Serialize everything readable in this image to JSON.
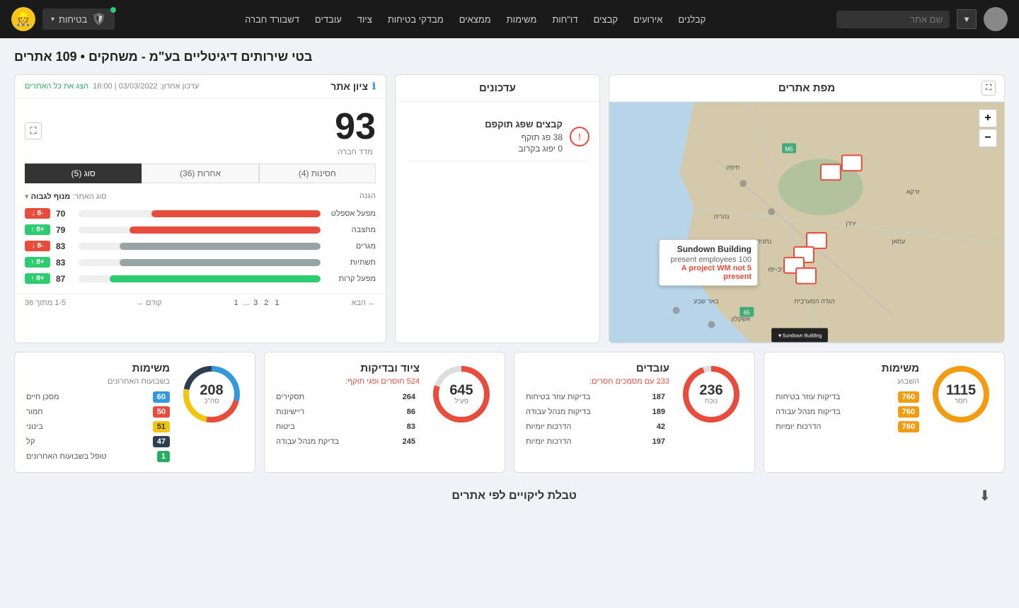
{
  "header": {
    "search_placeholder": "שם אתר",
    "nav_items": [
      "קבלנים",
      "אירועים",
      "קבצים",
      "דו\"חות",
      "משימות",
      "ממצאים",
      "מבדקי בטיחות",
      "ציוד",
      "עובדים",
      "דשבורד חברה"
    ],
    "security_btn": "בטיחות",
    "dropdown_arrow": "▾"
  },
  "page": {
    "title": "בטי שירותים דיגיטליים בע\"מ - משחקים • 109 אתרים"
  },
  "map": {
    "title": "מפת אתרים",
    "popup_title": "Sundown Building",
    "popup_line1": "100 present employees",
    "popup_wm": "5 A project",
    "popup_wm_label": "WM not present"
  },
  "updates": {
    "title": "עדכונים",
    "items": [
      {
        "label": "קבצים שפג תוקפם",
        "count": ""
      },
      {
        "label": "38 פג תוקף",
        "count": ""
      },
      {
        "label": "0 יפוג בקרוב",
        "count": ""
      }
    ]
  },
  "score": {
    "title": "ציון אתר",
    "update_label": "עדכון אחרון: 03/03/2022 | 16:00",
    "view_all_link": "הצג את כל האתרים",
    "score_number": "93",
    "score_sublabel": "מדד חברה",
    "type_label": "סוג האתר:",
    "type_value": "מנוף לגבוה",
    "tabs": [
      {
        "label": "חסינות (4)",
        "active": false
      },
      {
        "label": "אחרות (36)",
        "active": false
      },
      {
        "label": "סוג (5)",
        "active": true
      }
    ],
    "header_legend": "הגנה",
    "rows": [
      {
        "label": "מפעל אספלט",
        "value": 70,
        "badge": "-8",
        "badge_type": "red",
        "bar_color": "#e74c3c",
        "bar_pct": 70
      },
      {
        "label": "מחצבה",
        "value": 79,
        "badge": "+8",
        "badge_type": "green",
        "bar_color": "#e74c3c",
        "bar_pct": 79
      },
      {
        "label": "מגרים",
        "value": 83,
        "badge": "-8",
        "badge_type": "red",
        "bar_color": "#95a5a6",
        "bar_pct": 83
      },
      {
        "label": "תשתיות",
        "value": 83,
        "badge": "+8",
        "badge_type": "green",
        "bar_color": "#95a5a6",
        "bar_pct": 83
      },
      {
        "label": "מפעל קרות",
        "value": 87,
        "badge": "+8",
        "badge_type": "green",
        "bar_color": "#2ecc71",
        "bar_pct": 87
      }
    ],
    "pagination": {
      "range": "1-5 מתוך 36",
      "pages": [
        "1",
        "2",
        "3",
        "...",
        "1"
      ],
      "next": "הבא",
      "prev": "קודם"
    }
  },
  "stats": [
    {
      "id": "missions1",
      "title": "משימות",
      "subtitle": "השבוע",
      "subtitle_color": "normal",
      "number": "1115",
      "sublabel": "חסר",
      "donut_segments": [
        {
          "color": "#f39c12",
          "pct": 100
        }
      ],
      "donut_bg": "#ddd",
      "rows": [
        {
          "label": "בדיקות עוזר בטיחות",
          "badge": "760",
          "badge_color": "orange"
        },
        {
          "label": "בדיקות מנהל עבודה",
          "badge": "760",
          "badge_color": "orange"
        },
        {
          "label": "הדרכות יומיות",
          "badge": "760",
          "badge_color": "orange"
        }
      ]
    },
    {
      "id": "workers",
      "title": "עובדים",
      "subtitle": "233 עם מסמכים חסרים:",
      "subtitle_color": "red",
      "number": "236",
      "sublabel": "נוכח",
      "donut_segments": [
        {
          "color": "#e74c3c",
          "pct": 95
        }
      ],
      "donut_bg": "#ddd",
      "rows": [
        {
          "label": "בדיקות עוזר בטיחות",
          "badge": "187",
          "badge_color": "none"
        },
        {
          "label": "בדיקות מנהל עבודה",
          "badge": "189",
          "badge_color": "none"
        },
        {
          "label": "הדרכות יומיות",
          "badge": "42",
          "badge_color": "none"
        },
        {
          "label": "הדרכות יומיות",
          "badge": "197",
          "badge_color": "none"
        }
      ]
    },
    {
      "id": "inspections",
      "title": "ציוד ובדיקות",
      "subtitle": "524 חוסרים ופגי תוקף:",
      "subtitle_color": "red",
      "number": "645",
      "sublabel": "פעיל",
      "donut_segments": [
        {
          "color": "#e74c3c",
          "pct": 80
        }
      ],
      "donut_bg": "#ddd",
      "rows": [
        {
          "label": "תסקירים",
          "badge": "264",
          "badge_color": "none"
        },
        {
          "label": "ריישיונות",
          "badge": "86",
          "badge_color": "none"
        },
        {
          "label": "ביטוח",
          "badge": "83",
          "badge_color": "none"
        },
        {
          "label": "בדיקת מנהל עבודה",
          "badge": "245",
          "badge_color": "none"
        }
      ]
    },
    {
      "id": "missions2",
      "title": "משימות",
      "subtitle": "בשבועות האחרונים",
      "subtitle_color": "normal",
      "number": "208",
      "sublabel": "סה\"כ",
      "donut_segments": [
        {
          "color": "#3498db",
          "pct": 29
        },
        {
          "color": "#e74c3c",
          "pct": 24
        },
        {
          "color": "#f1c40f",
          "pct": 25
        },
        {
          "color": "#2c3e50",
          "pct": 22
        }
      ],
      "donut_bg": "#eee",
      "rows": [
        {
          "label": "מסכן חיים",
          "badge": "60",
          "badge_color": "blue"
        },
        {
          "label": "חמור",
          "badge": "50",
          "badge_color": "red2"
        },
        {
          "label": "בינוני",
          "badge": "51",
          "badge_color": "yellow"
        },
        {
          "label": "קל",
          "badge": "47",
          "badge_color": "dark"
        },
        {
          "label": "טופל בשבועות האחרונים",
          "badge": "1",
          "badge_color": "green2"
        }
      ]
    }
  ],
  "footer": {
    "table_title": "טבלת ליקויים לפי אתרים",
    "download_icon": "⬇"
  }
}
